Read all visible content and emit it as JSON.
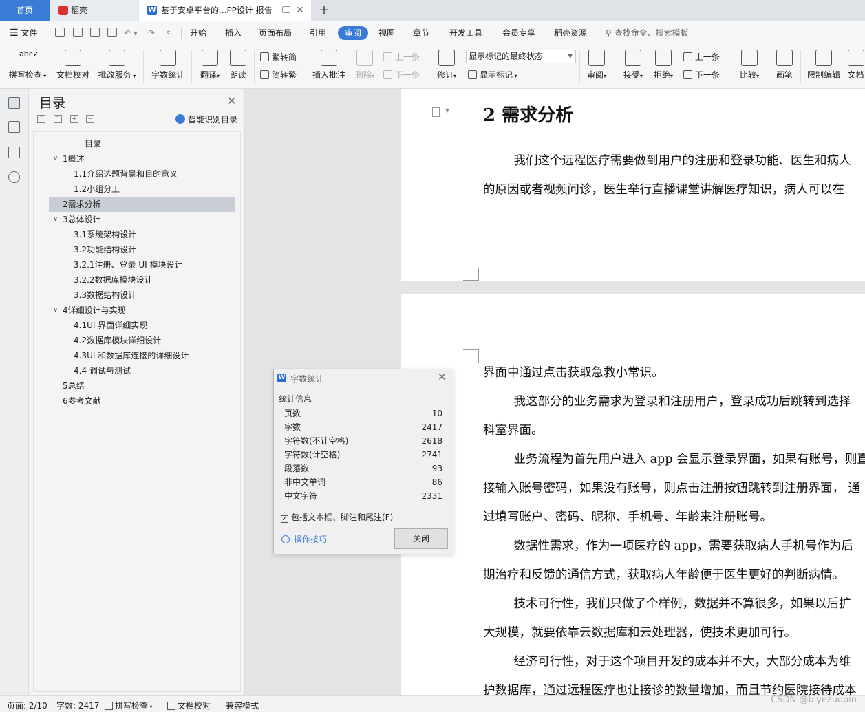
{
  "tabs": {
    "home": "首页",
    "daoke": "稻壳",
    "doc": "基于安卓平台的...PP设计 报告",
    "add": "+"
  },
  "menubar": {
    "file": "文件",
    "items": [
      "开始",
      "插入",
      "页面布局",
      "引用",
      "审阅",
      "视图",
      "章节",
      "开发工具",
      "会员专享",
      "稻壳资源"
    ],
    "active": "审阅",
    "search": "查找命令、搜索模板"
  },
  "ribbon": {
    "spellcheck": "拼写检查",
    "doc_proof": "文档校对",
    "annotate_service": "批改服务",
    "word_count": "字数统计",
    "translate": "翻译",
    "read_aloud": "朗读",
    "to_traditional": "繁转简",
    "to_simplified": "简转繁",
    "insert_comment": "插入批注",
    "delete": "删除",
    "prev_comment": "上一条",
    "next_comment": "下一条",
    "revise": "修订",
    "markup_state": "显示标记的最终状态",
    "show_markup": "显示标记",
    "review": "审阅",
    "accept": "接受",
    "reject": "拒绝",
    "prev_change": "上一条",
    "next_change": "下一条",
    "compare": "比较",
    "pen": "画笔",
    "restrict_edit": "限制编辑",
    "doc_more": "文档"
  },
  "toc": {
    "title": "目录",
    "smart_toc": "智能识别目录",
    "items": [
      {
        "text": "目录",
        "level": 0
      },
      {
        "text": "1概述",
        "level": 1,
        "expanded": true
      },
      {
        "text": "1.1介绍选题背景和目的意义",
        "level": 2
      },
      {
        "text": "1.2小组分工",
        "level": 2
      },
      {
        "text": "2需求分析",
        "level": 1,
        "selected": true
      },
      {
        "text": "3总体设计",
        "level": 1,
        "expanded": true
      },
      {
        "text": "3.1系统架构设计",
        "level": 2
      },
      {
        "text": "3.2功能结构设计",
        "level": 2
      },
      {
        "text": "3.2.1注册、登录 UI 模块设计",
        "level": 2
      },
      {
        "text": "3.2.2数据库模块设计",
        "level": 2
      },
      {
        "text": "3.3数据结构设计",
        "level": 2
      },
      {
        "text": "4详细设计与实现",
        "level": 1,
        "expanded": true
      },
      {
        "text": "4.1UI 界面详细实现",
        "level": 2
      },
      {
        "text": "4.2数据库模块详细设计",
        "level": 2
      },
      {
        "text": "4.3UI 和数据库连接的详细设计",
        "level": 2
      },
      {
        "text": "4.4 调试与测试",
        "level": 2
      },
      {
        "text": "5总结",
        "level": 1
      },
      {
        "text": "6参考文献",
        "level": 1
      }
    ]
  },
  "document": {
    "heading": "2  需求分析",
    "page1_lines": [
      "        我们这个远程医疗需要做到用户的注册和登录功能、医生和病人",
      "的原因或者视频问诊，医生举行直播课堂讲解医疗知识，病人可以在"
    ],
    "page2_lines": [
      "界面中通过点击获取急救小常识。",
      "        我这部分的业务需求为登录和注册用户，登录成功后跳转到选择",
      "科室界面。",
      "        业务流程为首先用户进入 app 会显示登录界面，如果有账号，则直",
      "接输入账号密码，如果没有账号，则点击注册按钮跳转到注册界面， 通",
      "过填写账户、密码、昵称、手机号、年龄来注册账号。",
      "        数据性需求，作为一项医疗的 app，需要获取病人手机号作为后",
      "期治疗和反馈的通信方式，获取病人年龄便于医生更好的判断病情。",
      "        技术可行性，我们只做了个样例，数据并不算很多，如果以后扩",
      "大规模，就要依靠云数据库和云处理器，使技术更加可行。",
      "        经济可行性，对于这个项目开发的成本并不大，大部分成本为维",
      "护数据库，通过远程医疗也让接诊的数量增加，而且节约医院接待成本"
    ]
  },
  "word_count_dialog": {
    "title": "字数统计",
    "section": "统计信息",
    "rows": [
      {
        "label": "页数",
        "value": "10"
      },
      {
        "label": "字数",
        "value": "2417"
      },
      {
        "label": "字符数(不计空格)",
        "value": "2618"
      },
      {
        "label": "字符数(计空格)",
        "value": "2741"
      },
      {
        "label": "段落数",
        "value": "93"
      },
      {
        "label": "非中文单词",
        "value": "86"
      },
      {
        "label": "中文字符",
        "value": "2331"
      }
    ],
    "include_checkbox": "包括文本框、脚注和尾注(F)",
    "include_checked": true,
    "tips": "操作技巧",
    "close": "关闭"
  },
  "status": {
    "page": "页面: 2/10",
    "words": "字数: 2417",
    "spellcheck": "拼写检查",
    "doc_proof": "文档校对",
    "compat": "兼容模式",
    "watermark": "CSDN @biyezuopin"
  },
  "colors": {
    "accent": "#3a7bd5",
    "wps_red": "#d9322e"
  }
}
